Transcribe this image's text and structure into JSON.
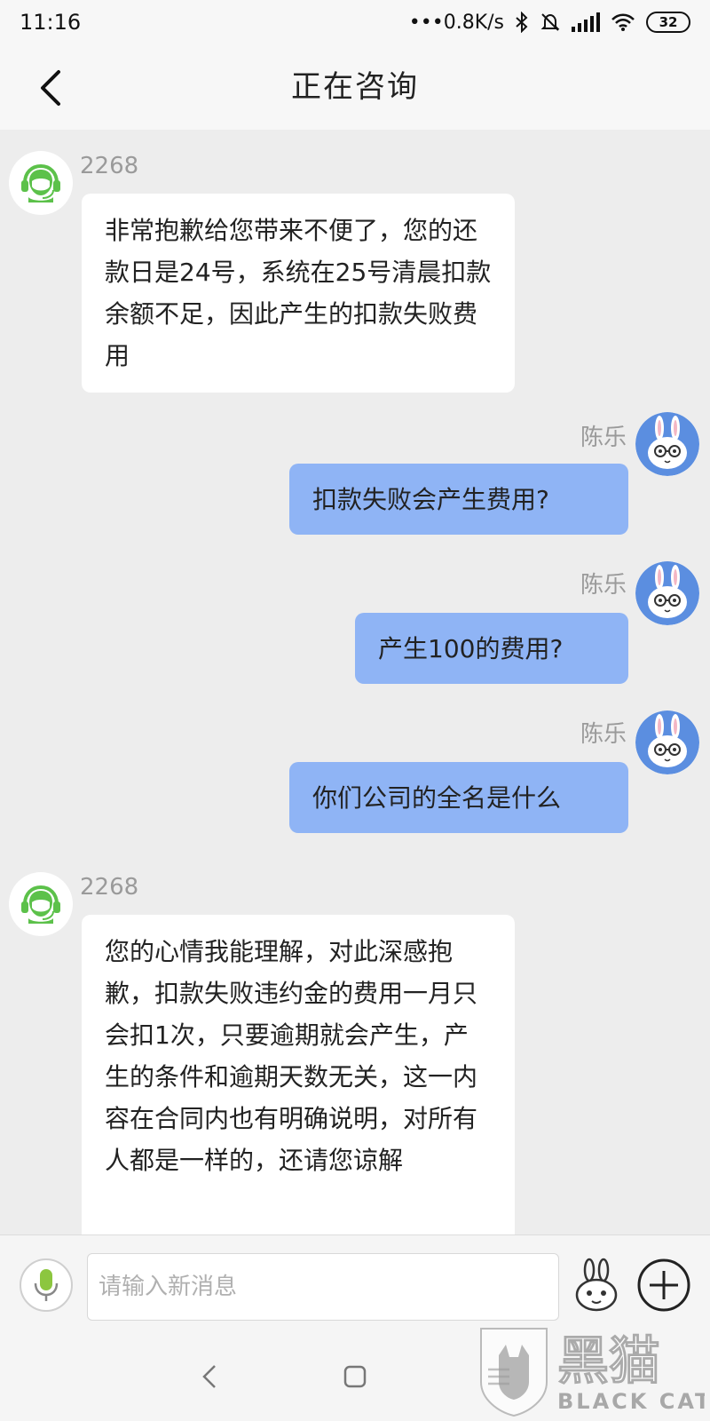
{
  "status_bar": {
    "time": "11:16",
    "network_speed": "•••0.8K/s",
    "battery": "32"
  },
  "header": {
    "title": "正在咨询",
    "back_icon": "chevron-left-icon"
  },
  "messages": [
    {
      "side": "in",
      "sender": "2268",
      "avatar": "agent-headset-icon",
      "text": "非常抱歉给您带来不便了，您的还款日是24号，系统在25号清晨扣款余额不足，因此产生的扣款失败费用"
    },
    {
      "side": "out",
      "sender": "陈乐",
      "avatar": "rabbit-avatar-icon",
      "text": "扣款失败会产生费用?"
    },
    {
      "side": "out",
      "sender": "陈乐",
      "avatar": "rabbit-avatar-icon",
      "text": "产生100的费用?"
    },
    {
      "side": "out",
      "sender": "陈乐",
      "avatar": "rabbit-avatar-icon",
      "text": "你们公司的全名是什么"
    },
    {
      "side": "in",
      "sender": "2268",
      "avatar": "agent-headset-icon",
      "text": "您的心情我能理解，对此深感抱歉，扣款失败违约金的费用一月只会扣1次，只要逾期就会产生，产生的条件和逾期天数无关，这一内容在合同内也有明确说明，对所有人都是一样的，还请您谅解"
    }
  ],
  "input_bar": {
    "placeholder": "请输入新消息",
    "value": "",
    "mic_icon": "microphone-icon",
    "emoji_icon": "rabbit-emoji-icon",
    "plus_icon": "plus-circle-icon"
  },
  "nav_bar": {
    "back_icon": "nav-back-icon",
    "home_icon": "nav-home-icon",
    "menu_icon": "nav-menu-icon"
  },
  "watermark": {
    "text_cn": "黑猫",
    "text_en": "BLACK CAT"
  },
  "colors": {
    "outgoing_bubble": "#8fb4f5",
    "incoming_bubble": "#ffffff",
    "chat_background": "#ededed",
    "agent_avatar": "#5cc14a"
  }
}
